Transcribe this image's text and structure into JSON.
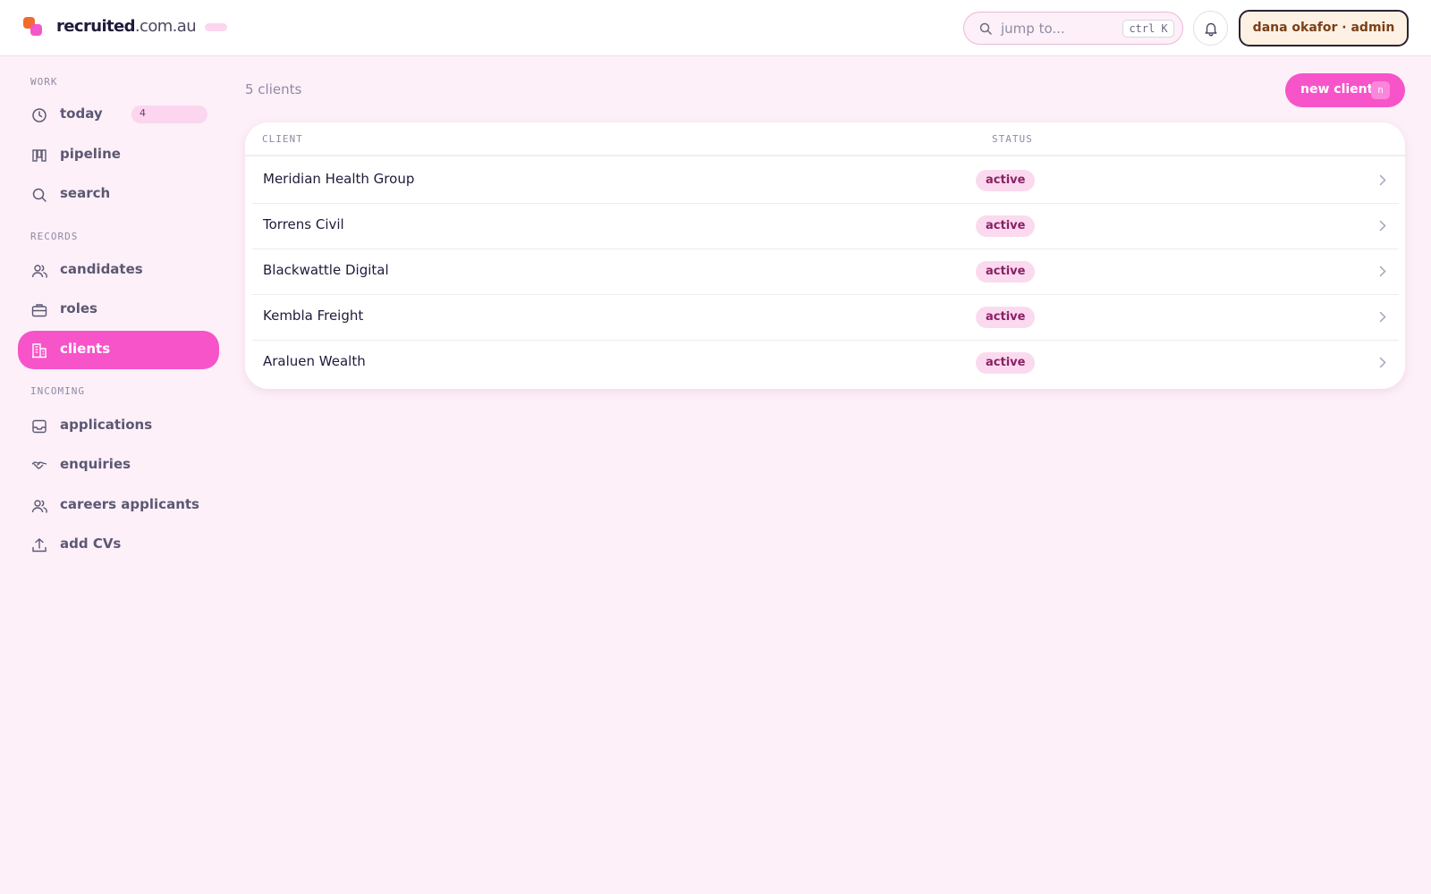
{
  "header": {
    "brand_bold": "recruited",
    "brand_rest": ".com.au",
    "search_placeholder": "jump to...",
    "search_shortcut": "ctrl K",
    "user_label": "dana okafor · admin"
  },
  "sidebar": {
    "sections": [
      {
        "label": "WORK"
      },
      {
        "label": "RECORDS"
      },
      {
        "label": "INCOMING"
      }
    ],
    "items": [
      {
        "label": "today",
        "icon": "clock-icon",
        "badge": "4"
      },
      {
        "label": "pipeline",
        "icon": "kanban-icon"
      },
      {
        "label": "search",
        "icon": "search-icon"
      },
      {
        "label": "candidates",
        "icon": "users-icon"
      },
      {
        "label": "roles",
        "icon": "briefcase-icon"
      },
      {
        "label": "clients",
        "icon": "building-icon",
        "active": true
      },
      {
        "label": "applications",
        "icon": "inbox-icon"
      },
      {
        "label": "enquiries",
        "icon": "handshake-icon"
      },
      {
        "label": "careers applicants",
        "icon": "users-icon"
      },
      {
        "label": "add CVs",
        "icon": "upload-icon"
      }
    ]
  },
  "main": {
    "count_label": "5 clients",
    "new_button_label": "new client",
    "new_button_shortcut": "n",
    "table": {
      "columns": [
        "CLIENT",
        "STATUS"
      ],
      "rows": [
        {
          "client": "Meridian Health Group",
          "status": "active"
        },
        {
          "client": "Torrens Civil",
          "status": "active"
        },
        {
          "client": "Blackwattle Digital",
          "status": "active"
        },
        {
          "client": "Kembla Freight",
          "status": "active"
        },
        {
          "client": "Araluen Wealth",
          "status": "active"
        }
      ]
    }
  },
  "colors": {
    "accent": "#f754c9",
    "background": "#fdf0f8",
    "status_bg": "#fbdaef",
    "status_text": "#8a2165"
  }
}
